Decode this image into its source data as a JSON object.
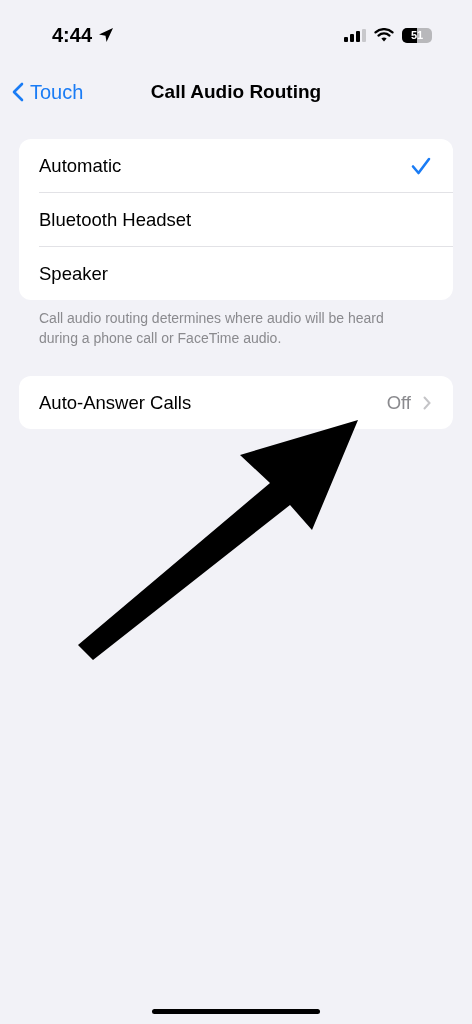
{
  "status_bar": {
    "time": "4:44",
    "battery": "51"
  },
  "nav": {
    "back": "Touch",
    "title": "Call Audio Routing"
  },
  "routing_options": [
    {
      "label": "Automatic",
      "selected": true
    },
    {
      "label": "Bluetooth Headset",
      "selected": false
    },
    {
      "label": "Speaker",
      "selected": false
    }
  ],
  "routing_footer": "Call audio routing determines where audio will be heard during a phone call or FaceTime audio.",
  "auto_answer": {
    "label": "Auto-Answer Calls",
    "value": "Off"
  }
}
